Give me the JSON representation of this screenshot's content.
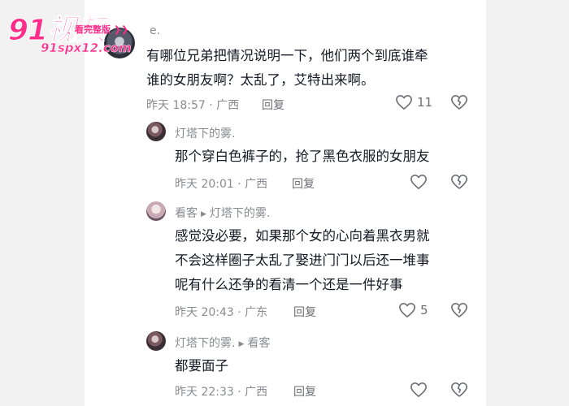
{
  "watermark": {
    "logo": "91视频",
    "tagline": "看完整版 ❯❯",
    "url": "91spx12.com"
  },
  "comments": [
    {
      "author": "e.",
      "text_lines": [
        "有哪位兄弟把情况说明一下，他们两个到底谁牵",
        "谁的女朋友啊？太乱了，艾特出来啊。"
      ],
      "time": "昨天 18:57",
      "location": "广西",
      "reply_label": "回复",
      "likes": "11"
    }
  ],
  "replies": [
    {
      "author": "灯塔下的雾.",
      "reply_to": "",
      "text_lines": [
        "那个穿白色裤子的，抢了黑色衣服的女朋友"
      ],
      "time": "昨天 20:01",
      "location": "广西",
      "reply_label": "回复",
      "likes": ""
    },
    {
      "author": "看客",
      "reply_to": "灯塔下的雾.",
      "text_lines": [
        "感觉没必要，如果那个女的心向着黑衣男就",
        "不会这样圈子太乱了娶进门门以后还一堆事",
        "呢有什么还争的看清一个还是一件好事"
      ],
      "time": "昨天 20:43",
      "location": "广东",
      "reply_label": "回复",
      "likes": "5"
    },
    {
      "author": "灯塔下的雾.",
      "reply_to": "看客",
      "text_lines": [
        "都要面子"
      ],
      "time": "昨天 22:33",
      "location": "广西",
      "reply_label": "回复",
      "likes": ""
    }
  ],
  "separator": " · ",
  "icons": [
    "heart-icon",
    "dislike-heart-icon"
  ]
}
